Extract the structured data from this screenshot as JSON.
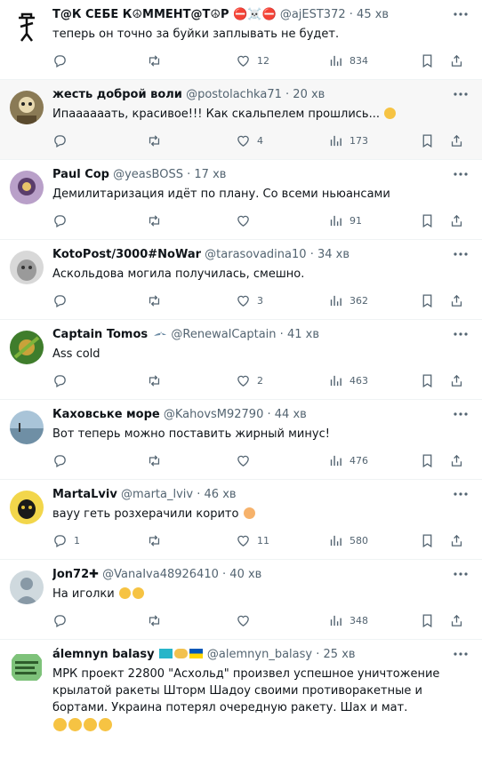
{
  "icons": {
    "reply": "reply-icon",
    "retweet": "retweet-icon",
    "like": "heart-icon",
    "views": "views-icon",
    "bookmark": "bookmark-icon",
    "share": "share-icon",
    "more": "more-dots-icon"
  },
  "colors": {
    "text": "#0f1419",
    "muted": "#536471",
    "divider": "#eff3f4",
    "hover_bg": "#f7f7f7"
  },
  "tweets": [
    {
      "name": "Т@К СЕБЕ К☮ММЕНТ@Т☮Р ⛔☠️⛔",
      "handle": "@ajEST372",
      "time": "45 хв",
      "text": "теперь он точно за буйки заплывать не будет.",
      "likes": "12",
      "views": "834"
    },
    {
      "name": "жесть доброй воли",
      "handle": "@postolachka71",
      "time": "20 хв",
      "text": "Ипаааааать, красивое!!! Как скальпелем прошлись...",
      "likes": "4",
      "views": "173"
    },
    {
      "name": "Paul Cop",
      "handle": "@yeasBOSS",
      "time": "17 хв",
      "text": "Демилитаризация идёт по плану. Со всеми ньюансами",
      "likes": "",
      "views": "91"
    },
    {
      "name": "KotoPost/3000#NoWar",
      "handle": "@tarasovadina10",
      "time": "34 хв",
      "text": "Аскольдова могила получилась, смешно.",
      "likes": "3",
      "views": "362"
    },
    {
      "name": "Captain Tomos",
      "handle": "@RenewalCaptain",
      "time": "41 хв",
      "text": "Ass cold",
      "likes": "2",
      "views": "463"
    },
    {
      "name": "Каховське море",
      "handle": "@KahovsM92790",
      "time": "44 хв",
      "text": "Вот теперь можно поставить жирный минус!",
      "likes": "",
      "views": "476"
    },
    {
      "name": "MartaLviv",
      "handle": "@marta_lviv",
      "time": "46 хв",
      "text": "вауу геть розхерачили корито",
      "replies": "1",
      "likes": "11",
      "views": "580"
    },
    {
      "name": "Jon72✚",
      "handle": "@VanaIva48926410",
      "time": "40 хв",
      "text": "На иголки",
      "likes": "",
      "views": "348"
    },
    {
      "name": "álemnyn balasy",
      "handle": "@alemnyn_balasy",
      "time": "25 хв",
      "text": "МРК проект 22800 \"Асхольд\" произвел успешное уничтожение крылатой ракеты Шторм Шадоу своими противоракетные и бортами. Украина потерял очередную ракету. Шах и мат."
    }
  ]
}
